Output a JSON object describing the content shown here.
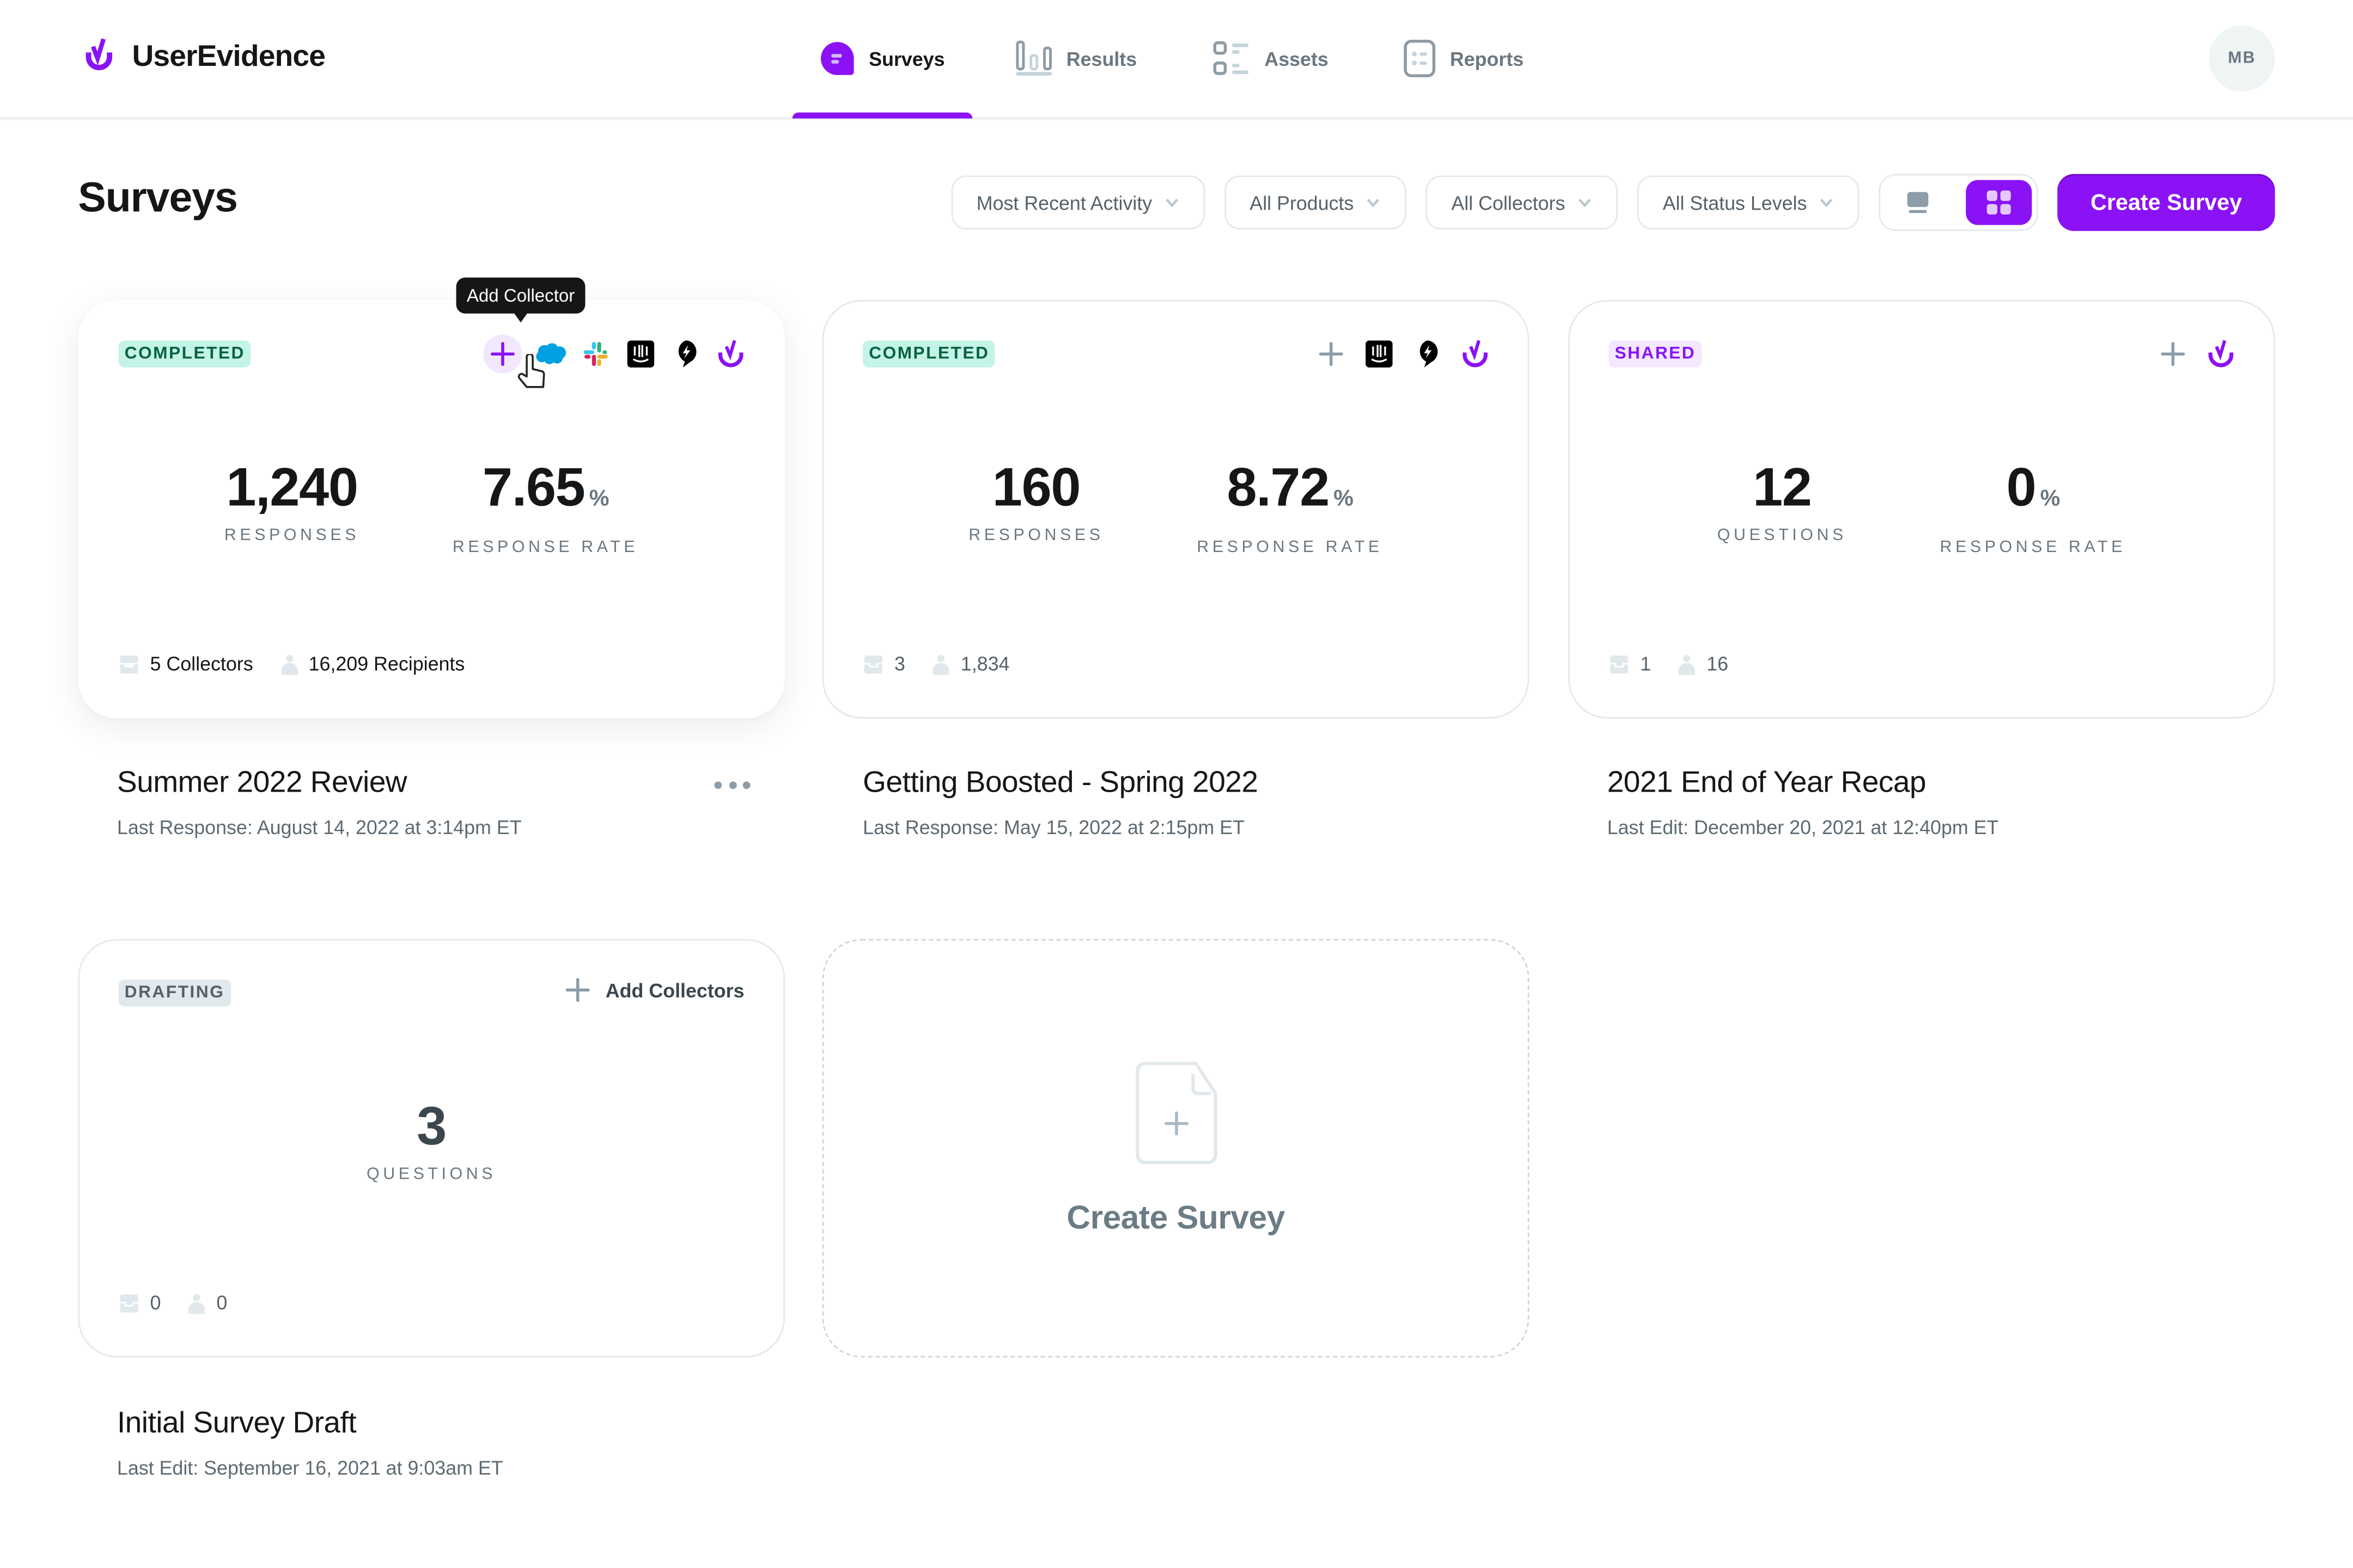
{
  "app": {
    "brand": "UserEvidence",
    "accent": "#8a12f5",
    "nav": [
      {
        "label": "Surveys",
        "icon": "survey-bubble-icon",
        "active": true
      },
      {
        "label": "Results",
        "icon": "bar-chart-icon",
        "active": false
      },
      {
        "label": "Assets",
        "icon": "list-icon",
        "active": false
      },
      {
        "label": "Reports",
        "icon": "report-icon",
        "active": false
      }
    ],
    "user_initials": "MB"
  },
  "toolbar": {
    "title": "Surveys",
    "filters": [
      {
        "label": "Most Recent Activity"
      },
      {
        "label": "All Products"
      },
      {
        "label": "All Collectors"
      },
      {
        "label": "All Status Levels"
      }
    ],
    "view_modes": [
      {
        "name": "list-view",
        "active": false
      },
      {
        "name": "grid-view",
        "active": true
      }
    ],
    "create_label": "Create Survey"
  },
  "tooltip": "Add Collector",
  "surveys": [
    {
      "status": "COMPLETED",
      "status_color": "#06633f",
      "collector_icons": [
        "add-icon",
        "salesforce-icon",
        "slack-icon",
        "intercom-icon",
        "drift-icon",
        "userevidence-icon"
      ],
      "stat1_value": "1,240",
      "stat1_label": "RESPONSES",
      "stat2_value": "7.65",
      "stat2_unit": "%",
      "stat2_label": "RESPONSE RATE",
      "collectors": "5 Collectors",
      "recipients": "16,209 Recipients",
      "title": "Summer 2022 Review",
      "subtitle": "Last Response: August 14, 2022 at 3:14pm ET"
    },
    {
      "status": "COMPLETED",
      "status_color": "#06633f",
      "collector_icons": [
        "add-icon",
        "intercom-icon",
        "drift-icon",
        "userevidence-icon"
      ],
      "stat1_value": "160",
      "stat1_label": "RESPONSES",
      "stat2_value": "8.72",
      "stat2_unit": "%",
      "stat2_label": "RESPONSE RATE",
      "collectors": "3",
      "recipients": "1,834",
      "title": "Getting Boosted - Spring 2022",
      "subtitle": "Last Response: May 15, 2022 at 2:15pm ET"
    },
    {
      "status": "SHARED",
      "status_color": "#8a12f5",
      "collector_icons": [
        "add-icon",
        "userevidence-icon"
      ],
      "stat1_value": "12",
      "stat1_label": "QUESTIONS",
      "stat2_value": "0",
      "stat2_unit": "%",
      "stat2_label": "RESPONSE RATE",
      "collectors": "1",
      "recipients": "16",
      "title": "2021 End of Year Recap",
      "subtitle": "Last Edit: December 20, 2021 at 12:40pm ET"
    },
    {
      "status": "DRAFTING",
      "status_color": "#55616a",
      "add_collectors_label": "Add Collectors",
      "stat1_value": "3",
      "stat1_label": "QUESTIONS",
      "collectors": "0",
      "recipients": "0",
      "title": "Initial Survey Draft",
      "subtitle": "Last Edit: September 16, 2021 at 9:03am ET"
    }
  ],
  "create_card": {
    "label": "Create Survey"
  }
}
